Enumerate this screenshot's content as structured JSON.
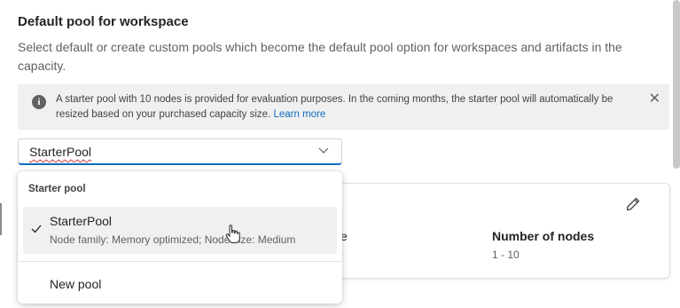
{
  "section": {
    "title": "Default pool for workspace",
    "description": "Select default or create custom pools which become the default pool option for workspaces and artifacts in the capacity."
  },
  "info_bar": {
    "icon": "info-icon",
    "text": "A starter pool with 10 nodes is provided for evaluation purposes. In the coming months, the starter pool will automatically be resized based on your purchased capacity size.",
    "link_text": "Learn more",
    "close_icon": "close-icon"
  },
  "dropdown": {
    "selected_value": "StarterPool",
    "chevron_icon": "chevron-down-icon"
  },
  "menu": {
    "group_header": "Starter pool",
    "items": [
      {
        "title": "StarterPool",
        "subtitle": "Node family: Memory optimized; Node size: Medium",
        "selected": true
      }
    ],
    "new_pool_label": "New pool"
  },
  "pool_card": {
    "partial_label": "e",
    "nodes_label": "Number of nodes",
    "nodes_value": "1 - 10",
    "edit_icon": "pencil-icon"
  },
  "colors": {
    "accent": "#0f6cbd",
    "info_bg": "#f0f0f0",
    "selected_bg": "#f0f0f0"
  }
}
